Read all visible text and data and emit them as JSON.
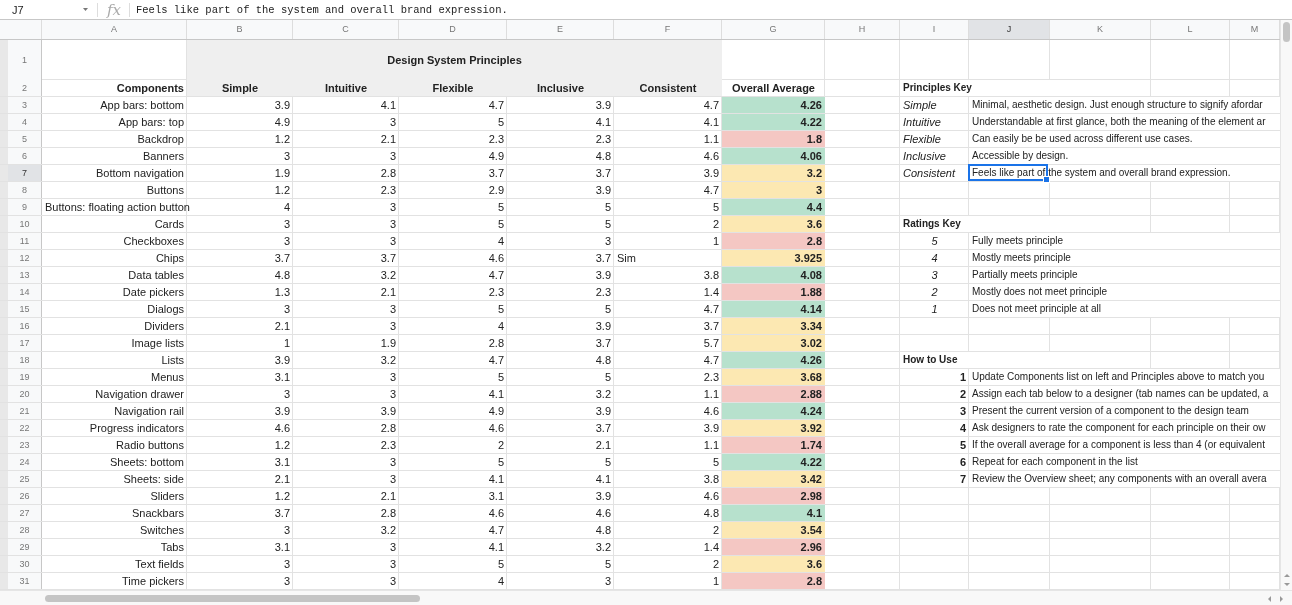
{
  "formula_bar": {
    "cell_ref": "J7",
    "fx_label": "fx",
    "content": "Feels like part of the system and overall brand expression."
  },
  "column_headers": [
    "A",
    "B",
    "C",
    "D",
    "E",
    "F",
    "G",
    "H",
    "I",
    "J",
    "K",
    "L",
    "M"
  ],
  "row_numbers": [
    "1",
    "2",
    "3",
    "4",
    "5",
    "6",
    "7",
    "8",
    "9",
    "10",
    "11",
    "12",
    "13",
    "14",
    "15",
    "16",
    "17",
    "18",
    "19",
    "20",
    "21",
    "22",
    "23",
    "24",
    "25",
    "26",
    "27",
    "28",
    "29",
    "30",
    "31"
  ],
  "table_title": "Design System Principles",
  "table_columns": [
    "Components",
    "Simple",
    "Intuitive",
    "Flexible",
    "Inclusive",
    "Consistent",
    "Overall Average"
  ],
  "components": [
    {
      "name": "App bars: bottom",
      "scores": [
        "3.9",
        "4.1",
        "4.7",
        "3.9",
        "4.7"
      ],
      "average": "4.26",
      "color": "#b7e1cd"
    },
    {
      "name": "App bars: top",
      "scores": [
        "4.9",
        "3",
        "5",
        "4.1",
        "4.1"
      ],
      "average": "4.22",
      "color": "#b7e1cd"
    },
    {
      "name": "Backdrop",
      "scores": [
        "1.2",
        "2.1",
        "2.3",
        "2.3",
        "1.1"
      ],
      "average": "1.8",
      "color": "#f4c7c3"
    },
    {
      "name": "Banners",
      "scores": [
        "3",
        "3",
        "4.9",
        "4.8",
        "4.6"
      ],
      "average": "4.06",
      "color": "#b7e1cd"
    },
    {
      "name": "Bottom navigation",
      "scores": [
        "1.9",
        "2.8",
        "3.7",
        "3.7",
        "3.9"
      ],
      "average": "3.2",
      "color": "#fce8b2"
    },
    {
      "name": "Buttons",
      "scores": [
        "1.2",
        "2.3",
        "2.9",
        "3.9",
        "4.7"
      ],
      "average": "3",
      "color": "#fce8b2"
    },
    {
      "name": "Buttons: floating action button",
      "scores": [
        "4",
        "3",
        "5",
        "5",
        "5"
      ],
      "average": "4.4",
      "color": "#b7e1cd"
    },
    {
      "name": "Cards",
      "scores": [
        "3",
        "3",
        "5",
        "5",
        "2"
      ],
      "average": "3.6",
      "color": "#fce8b2"
    },
    {
      "name": "Checkboxes",
      "scores": [
        "3",
        "3",
        "4",
        "3",
        "1"
      ],
      "average": "2.8",
      "color": "#f4c7c3"
    },
    {
      "name": "Chips",
      "scores": [
        "3.7",
        "3.7",
        "4.6",
        "3.7"
      ],
      "note": "Sim",
      "average": "3.925",
      "color": "#fce8b2"
    },
    {
      "name": "Data tables",
      "scores": [
        "4.8",
        "3.2",
        "4.7",
        "3.9",
        "3.8"
      ],
      "average": "4.08",
      "color": "#b7e1cd"
    },
    {
      "name": "Date pickers",
      "scores": [
        "1.3",
        "2.1",
        "2.3",
        "2.3",
        "1.4"
      ],
      "average": "1.88",
      "color": "#f4c7c3"
    },
    {
      "name": "Dialogs",
      "scores": [
        "3",
        "3",
        "5",
        "5",
        "4.7"
      ],
      "average": "4.14",
      "color": "#b7e1cd"
    },
    {
      "name": "Dividers",
      "scores": [
        "2.1",
        "3",
        "4",
        "3.9",
        "3.7"
      ],
      "average": "3.34",
      "color": "#fce8b2"
    },
    {
      "name": "Image lists",
      "scores": [
        "1",
        "1.9",
        "2.8",
        "3.7",
        "5.7"
      ],
      "average": "3.02",
      "color": "#fce8b2"
    },
    {
      "name": "Lists",
      "scores": [
        "3.9",
        "3.2",
        "4.7",
        "4.8",
        "4.7"
      ],
      "average": "4.26",
      "color": "#b7e1cd"
    },
    {
      "name": "Menus",
      "scores": [
        "3.1",
        "3",
        "5",
        "5",
        "2.3"
      ],
      "average": "3.68",
      "color": "#fce8b2"
    },
    {
      "name": "Navigation drawer",
      "scores": [
        "3",
        "3",
        "4.1",
        "3.2",
        "1.1"
      ],
      "average": "2.88",
      "color": "#f4c7c3"
    },
    {
      "name": "Navigation rail",
      "scores": [
        "3.9",
        "3.9",
        "4.9",
        "3.9",
        "4.6"
      ],
      "average": "4.24",
      "color": "#b7e1cd"
    },
    {
      "name": "Progress indicators",
      "scores": [
        "4.6",
        "2.8",
        "4.6",
        "3.7",
        "3.9"
      ],
      "average": "3.92",
      "color": "#fce8b2"
    },
    {
      "name": "Radio buttons",
      "scores": [
        "1.2",
        "2.3",
        "2",
        "2.1",
        "1.1"
      ],
      "average": "1.74",
      "color": "#f4c7c3"
    },
    {
      "name": "Sheets: bottom",
      "scores": [
        "3.1",
        "3",
        "5",
        "5",
        "5"
      ],
      "average": "4.22",
      "color": "#b7e1cd"
    },
    {
      "name": "Sheets: side",
      "scores": [
        "2.1",
        "3",
        "4.1",
        "4.1",
        "3.8"
      ],
      "average": "3.42",
      "color": "#fce8b2"
    },
    {
      "name": "Sliders",
      "scores": [
        "1.2",
        "2.1",
        "3.1",
        "3.9",
        "4.6"
      ],
      "average": "2.98",
      "color": "#f4c7c3"
    },
    {
      "name": "Snackbars",
      "scores": [
        "3.7",
        "2.8",
        "4.6",
        "4.6",
        "4.8"
      ],
      "average": "4.1",
      "color": "#b7e1cd"
    },
    {
      "name": "Switches",
      "scores": [
        "3",
        "3.2",
        "4.7",
        "4.8",
        "2"
      ],
      "average": "3.54",
      "color": "#fce8b2"
    },
    {
      "name": "Tabs",
      "scores": [
        "3.1",
        "3",
        "4.1",
        "3.2",
        "1.4"
      ],
      "average": "2.96",
      "color": "#f4c7c3"
    },
    {
      "name": "Text fields",
      "scores": [
        "3",
        "3",
        "5",
        "5",
        "2"
      ],
      "average": "3.6",
      "color": "#fce8b2"
    },
    {
      "name": "Time pickers",
      "scores": [
        "3",
        "3",
        "4",
        "3",
        "1"
      ],
      "average": "2.8",
      "color": "#f4c7c3"
    }
  ],
  "principles_key": {
    "title": "Principles Key",
    "items": [
      {
        "term": "Simple",
        "description": "Minimal, aesthetic design. Just enough structure to signify afordar",
        "selected": false
      },
      {
        "term": "Intuitive",
        "description": "Understandable at first glance, both the meaning of the element ar",
        "selected": false
      },
      {
        "term": "Flexible",
        "description": "Can easily be be used across different use cases.",
        "selected": false
      },
      {
        "term": "Inclusive",
        "description": "Accessible by design.",
        "selected": false
      },
      {
        "term": "Consistent",
        "description": "Feels like part of the system and overall brand expression.",
        "selected": true
      }
    ]
  },
  "ratings_key": {
    "title": "Ratings Key",
    "items": [
      {
        "rating": "5",
        "description": "Fully meets principle"
      },
      {
        "rating": "4",
        "description": "Mostly meets principle"
      },
      {
        "rating": "3",
        "description": "Partially meets principle"
      },
      {
        "rating": "2",
        "description": "Mostly does not meet principle"
      },
      {
        "rating": "1",
        "description": "Does not meet principle at all"
      }
    ]
  },
  "how_to_use": {
    "title": "How to Use",
    "steps": [
      {
        "number": "1",
        "text": "Update Components list on left and Principles above to match you"
      },
      {
        "number": "2",
        "text": "Assign each tab below to a designer (tab names can be updated, a"
      },
      {
        "number": "3",
        "text": "Present the current version of a component to the design team"
      },
      {
        "number": "4",
        "text": "Ask designers to rate the component for each principle on their ow"
      },
      {
        "number": "5",
        "text": "If the overall average for a component is less than 4 (or equivalent"
      },
      {
        "number": "6",
        "text": "Repeat for each component in the list"
      },
      {
        "number": "7",
        "text": "Review the Overview sheet; any components with an overall avera"
      }
    ]
  }
}
